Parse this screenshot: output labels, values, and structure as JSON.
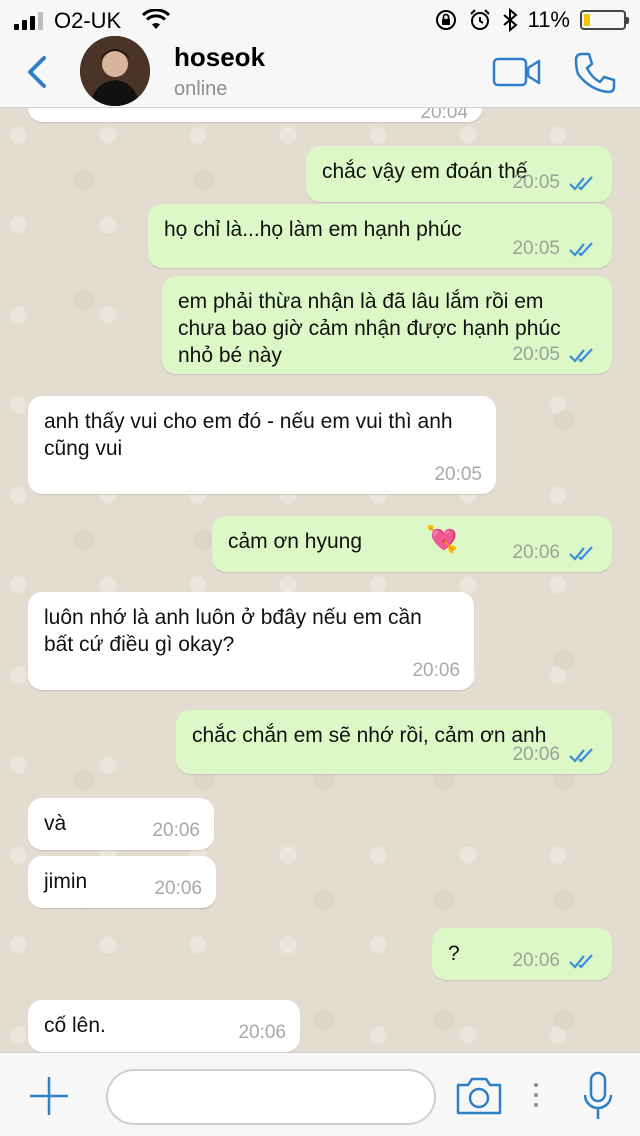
{
  "status_bar": {
    "carrier": "O2-UK",
    "battery": "11%"
  },
  "header": {
    "name": "hoseok",
    "status": "online"
  },
  "messages": [
    {
      "dir": "in",
      "text": "",
      "time": "20:04"
    },
    {
      "dir": "out",
      "text": "chắc vậy em đoán thế",
      "time": "20:05"
    },
    {
      "dir": "out",
      "text": "họ chỉ là...họ làm em hạnh phúc",
      "time": "20:05"
    },
    {
      "dir": "out",
      "text": "em phải thừa nhận là đã lâu lắm rồi em chưa bao giờ cảm nhận được hạnh phúc nhỏ bé này",
      "time": "20:05"
    },
    {
      "dir": "in",
      "text": "anh thấy vui cho em đó - nếu em vui thì anh cũng vui",
      "time": "20:05"
    },
    {
      "dir": "out",
      "text": "cảm ơn hyung",
      "time": "20:06",
      "emoji": "💘"
    },
    {
      "dir": "in",
      "text": "luôn nhớ là anh luôn ở bđây nếu em cần bất cứ điều gì okay?",
      "time": "20:06"
    },
    {
      "dir": "out",
      "text": "chắc chắn em sẽ nhớ rồi, cảm ơn anh",
      "time": "20:06"
    },
    {
      "dir": "in",
      "text": "và",
      "time": "20:06"
    },
    {
      "dir": "in",
      "text": "jimin",
      "time": "20:06"
    },
    {
      "dir": "out",
      "text": "?",
      "time": "20:06"
    },
    {
      "dir": "in",
      "text": "cố lên.",
      "time": "20:06"
    }
  ],
  "colors": {
    "accent": "#2f7fc8",
    "outgoing_bubble": "#dcf8c6",
    "incoming_bubble": "#ffffff",
    "read_ticks": "#3a8fd9"
  }
}
